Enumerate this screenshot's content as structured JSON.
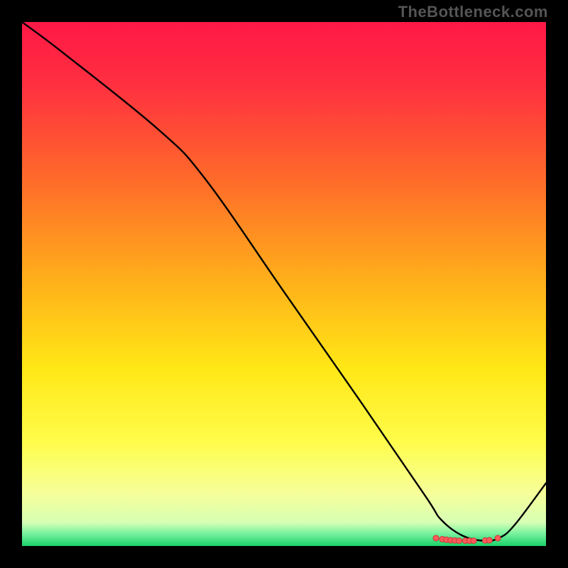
{
  "watermark": "TheBottleneck.com",
  "chart_data": {
    "type": "line",
    "title": "",
    "xlabel": "",
    "ylabel": "",
    "xlim": [
      0,
      100
    ],
    "ylim": [
      0,
      100
    ],
    "gradient_stops": [
      {
        "offset": 0.0,
        "color": "#ff1846"
      },
      {
        "offset": 0.12,
        "color": "#ff3040"
      },
      {
        "offset": 0.3,
        "color": "#ff6a2a"
      },
      {
        "offset": 0.5,
        "color": "#ffb21a"
      },
      {
        "offset": 0.66,
        "color": "#ffe716"
      },
      {
        "offset": 0.8,
        "color": "#fffc4a"
      },
      {
        "offset": 0.9,
        "color": "#f6ff9a"
      },
      {
        "offset": 0.955,
        "color": "#d7ffb4"
      },
      {
        "offset": 0.975,
        "color": "#7ef3a0"
      },
      {
        "offset": 1.0,
        "color": "#18d16a"
      }
    ],
    "series": [
      {
        "name": "bottleneck-curve",
        "color": "#000000",
        "x": [
          0,
          8,
          26,
          35,
          50,
          65,
          77,
          80,
          84,
          88,
          91,
          94,
          100
        ],
        "y": [
          100,
          94,
          79.5,
          70,
          48.5,
          27,
          9.5,
          5,
          2,
          1,
          1.5,
          4,
          12
        ]
      }
    ],
    "markers": {
      "name": "optimal-range",
      "color": "#ff5a5a",
      "stroke": "#c63a3a",
      "radius_px": 4,
      "points": [
        {
          "x": 79.0,
          "y": 1.5
        },
        {
          "x": 80.2,
          "y": 1.3
        },
        {
          "x": 81.0,
          "y": 1.2
        },
        {
          "x": 81.8,
          "y": 1.1
        },
        {
          "x": 82.6,
          "y": 1.05
        },
        {
          "x": 83.4,
          "y": 1.0
        },
        {
          "x": 84.6,
          "y": 1.0
        },
        {
          "x": 85.4,
          "y": 1.0
        },
        {
          "x": 86.2,
          "y": 1.0
        },
        {
          "x": 88.4,
          "y": 1.05
        },
        {
          "x": 89.2,
          "y": 1.1
        },
        {
          "x": 90.8,
          "y": 1.5
        }
      ]
    }
  }
}
